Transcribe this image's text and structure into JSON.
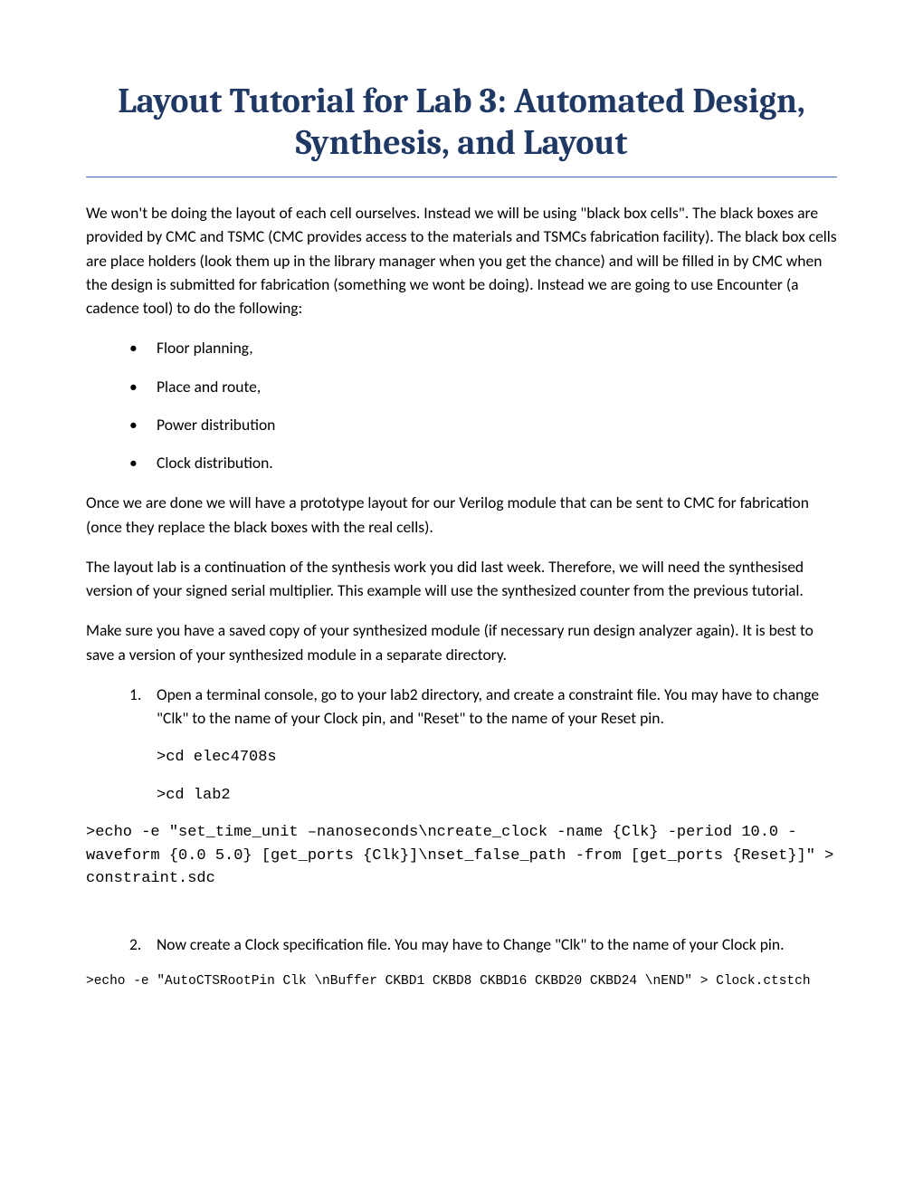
{
  "title": "Layout Tutorial for Lab 3: Automated Design, Synthesis, and Layout",
  "intro": "We won't be doing the layout of each cell ourselves. Instead we will be using \"black box cells\". The black boxes are provided by CMC and TSMC (CMC provides access to the materials and TSMCs fabrication facility). The black box cells are place holders (look them up in the library manager when you get the chance) and will be filled in by CMC when the design is submitted for fabrication (something we wont be doing). Instead we are going to use Encounter (a cadence tool) to do the following:",
  "bullets": [
    "Floor planning,",
    "Place and route,",
    "Power distribution",
    "Clock distribution."
  ],
  "para2": "Once we are done we will have a prototype layout for our Verilog module that can be sent to CMC for fabrication (once they replace the black boxes with the real cells).",
  "para3": "The layout lab is a continuation of the synthesis work you did last week. Therefore, we will need the synthesised version of your signed serial multiplier. This example will use the synthesized counter from the previous tutorial.",
  "para4": "Make sure you have a saved copy of your synthesized module (if necessary run design analyzer again). It is best to save a version of your synthesized module in a separate directory.",
  "step1": "Open a terminal console, go to your lab2 directory, and create a constraint file. You may have to change \"Clk\" to the name of your Clock pin, and \"Reset\" to the name of your Reset pin.",
  "cmd1": ">cd elec4708s",
  "cmd2": ">cd lab2",
  "cmd3": ">echo -e \"set_time_unit –nanoseconds\\ncreate_clock -name {Clk} -period 10.0 -waveform {0.0 5.0} [get_ports {Clk}]\\nset_false_path -from [get_ports {Reset}]\" > constraint.sdc",
  "step2": "Now create a Clock specification file. You may have to Change \"Clk\" to the name of your Clock pin.",
  "cmd4": ">echo -e \"AutoCTSRootPin Clk \\nBuffer CKBD1 CKBD8 CKBD16 CKBD20 CKBD24 \\nEND\" > Clock.ctstch"
}
